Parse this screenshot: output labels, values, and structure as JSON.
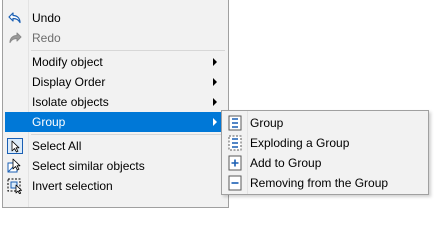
{
  "context_menu": {
    "items": [
      {
        "label": "Undo",
        "icon": "undo-icon"
      },
      {
        "label": "Redo",
        "icon": "redo-icon",
        "disabled": true
      },
      {
        "label": "Modify object",
        "has_submenu": true
      },
      {
        "label": "Display Order",
        "has_submenu": true
      },
      {
        "label": "Isolate objects",
        "has_submenu": true
      },
      {
        "label": "Group",
        "has_submenu": true,
        "highlighted": true
      },
      {
        "label": "Select All",
        "icon": "select-all-icon"
      },
      {
        "label": "Select similar objects",
        "icon": "select-similar-icon"
      },
      {
        "label": "Invert selection",
        "icon": "invert-selection-icon"
      }
    ]
  },
  "group_submenu": {
    "items": [
      {
        "label": "Group",
        "icon": "group-icon"
      },
      {
        "label": "Exploding a Group",
        "icon": "explode-group-icon"
      },
      {
        "label": "Add to Group",
        "icon": "add-to-group-icon"
      },
      {
        "label": "Removing from the Group",
        "icon": "remove-from-group-icon"
      }
    ]
  },
  "colors": {
    "highlight": "#0078d7",
    "menu_background": "#f2f2f2",
    "icon_blue": "#1a5fb4"
  }
}
